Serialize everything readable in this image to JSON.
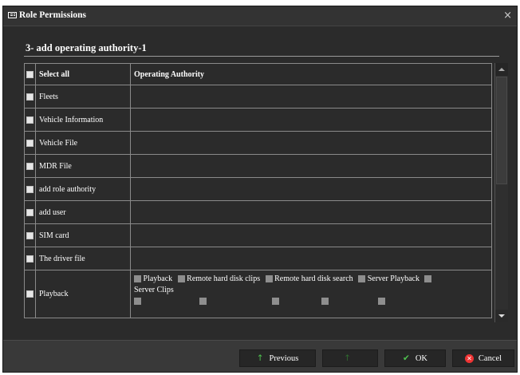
{
  "dialog": {
    "title": "Role Permissions",
    "close_glyph": "×",
    "heading": "3- add operating authority-1"
  },
  "table": {
    "headers": {
      "select_all": "Select all",
      "operating_authority": "Operating Authority"
    },
    "rows": [
      {
        "label": "Fleets"
      },
      {
        "label": "Vehicle Information"
      },
      {
        "label": "Vehicle File"
      },
      {
        "label": "MDR File"
      },
      {
        "label": "add role authority"
      },
      {
        "label": "add user"
      },
      {
        "label": "SIM card"
      },
      {
        "label": "The driver file"
      }
    ],
    "playback": {
      "label": "Playback",
      "options": [
        "Playback",
        "Remote hard disk clips",
        "Remote hard disk search",
        "Server Playback",
        "Server Clips"
      ]
    }
  },
  "footer": {
    "previous_label": "Previous",
    "next_label": "",
    "ok_label": "OK",
    "cancel_label": "Cancel"
  },
  "icons": {
    "title": "id-card-icon",
    "close": "close-icon",
    "previous": "arrow-up-icon",
    "next": "arrow-up-icon",
    "ok": "checkmark-icon",
    "cancel": "x-circle-icon"
  },
  "colors": {
    "background": "#2b2b2b",
    "ok_check": "#4fc24f",
    "cancel_badge": "#ee3333"
  }
}
